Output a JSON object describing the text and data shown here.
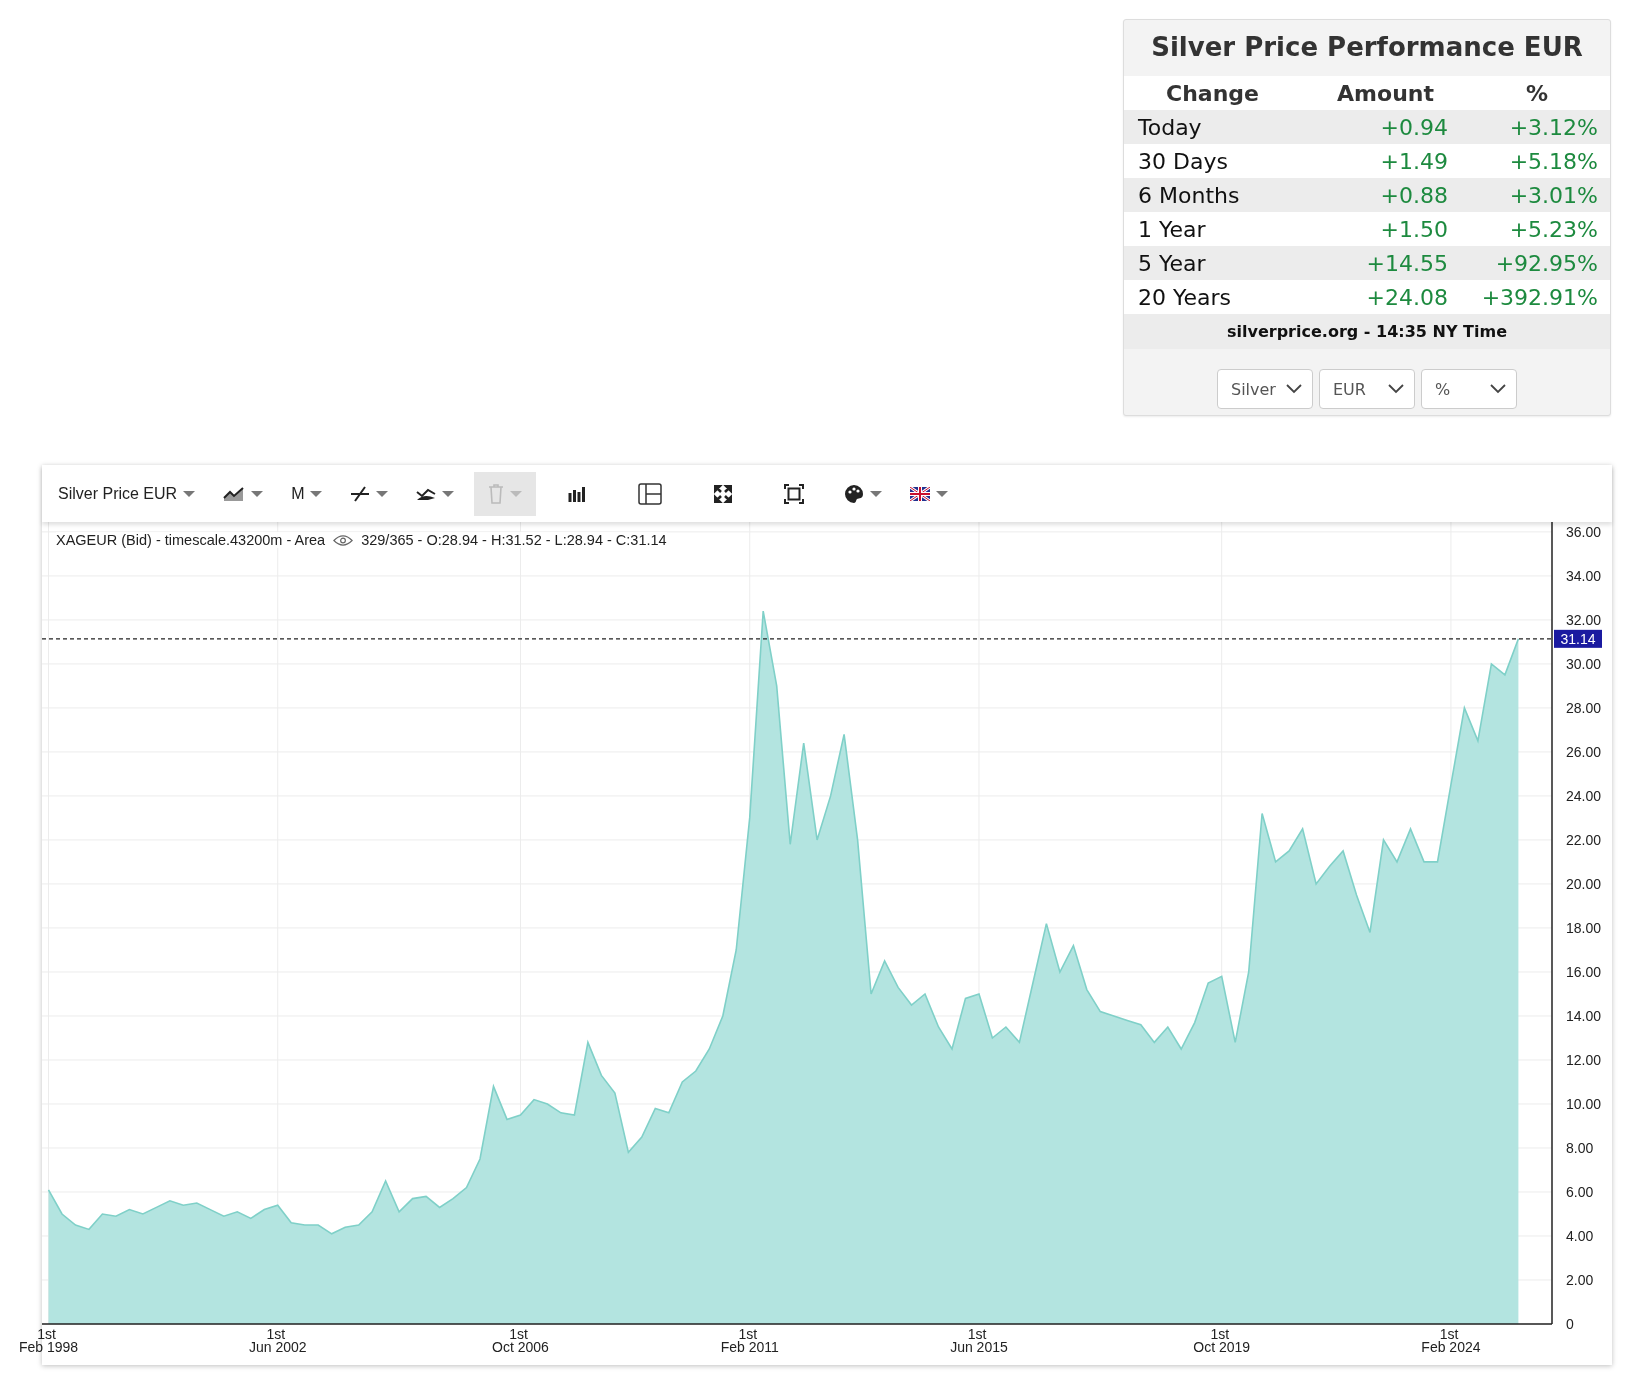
{
  "performance": {
    "title": "Silver Price Performance EUR",
    "columns": [
      "Change",
      "Amount",
      "%"
    ],
    "rows": [
      {
        "period": "Today",
        "amount": "+0.94",
        "percent": "+3.12%"
      },
      {
        "period": "30 Days",
        "amount": "+1.49",
        "percent": "+5.18%"
      },
      {
        "period": "6 Months",
        "amount": "+0.88",
        "percent": "+3.01%"
      },
      {
        "period": "1 Year",
        "amount": "+1.50",
        "percent": "+5.23%"
      },
      {
        "period": "5 Year",
        "amount": "+14.55",
        "percent": "+92.95%"
      },
      {
        "period": "20 Years",
        "amount": "+24.08",
        "percent": "+392.91%"
      }
    ],
    "footer": "silverprice.org - 14:35 NY Time",
    "selects": [
      {
        "value": "Silver"
      },
      {
        "value": "EUR"
      },
      {
        "value": "%"
      }
    ]
  },
  "chart": {
    "toolbar": {
      "symbol": "Silver Price EUR",
      "interval": "M",
      "delete_disabled": true
    },
    "legend": {
      "series": "XAGEUR (Bid) - timescale.43200m - Area",
      "stats": "329/365 - O:28.94 - H:31.52 - L:28.94 - C:31.14"
    },
    "chart_data": {
      "type": "area",
      "categories": [
        "1st Feb 1998",
        null,
        null,
        null,
        null,
        null,
        null,
        null,
        null,
        null,
        null,
        null,
        null,
        null,
        null,
        null,
        null,
        "1st Jun 2002",
        null,
        null,
        null,
        null,
        null,
        null,
        null,
        null,
        null,
        null,
        null,
        null,
        null,
        null,
        null,
        null,
        null,
        "1st Oct 2006",
        null,
        null,
        null,
        null,
        null,
        null,
        null,
        null,
        null,
        null,
        null,
        null,
        null,
        null,
        null,
        null,
        "1st Feb 2011",
        null,
        null,
        null,
        null,
        null,
        null,
        null,
        null,
        null,
        null,
        null,
        null,
        null,
        null,
        null,
        null,
        "1st Jun 2015",
        null,
        null,
        null,
        null,
        null,
        null,
        null,
        null,
        null,
        null,
        null,
        null,
        null,
        null,
        null,
        null,
        null,
        "1st Oct 2019",
        null,
        null,
        null,
        null,
        null,
        null,
        null,
        null,
        null,
        null,
        null,
        null,
        null,
        null,
        null,
        null,
        "1st Feb 2024",
        null,
        null,
        null,
        null,
        null
      ],
      "values": [
        6.1,
        5.0,
        4.5,
        4.3,
        5.0,
        4.9,
        5.2,
        5.0,
        5.3,
        5.6,
        5.4,
        5.5,
        5.2,
        4.9,
        5.1,
        4.8,
        5.2,
        5.4,
        4.6,
        4.5,
        4.5,
        4.1,
        4.4,
        4.5,
        5.1,
        6.5,
        5.1,
        5.7,
        5.8,
        5.3,
        5.7,
        6.2,
        7.5,
        10.8,
        9.3,
        9.5,
        10.2,
        10.0,
        9.6,
        9.5,
        12.8,
        11.3,
        10.5,
        7.8,
        8.5,
        9.8,
        9.6,
        11.0,
        11.5,
        12.5,
        14.0,
        17.0,
        23.0,
        32.4,
        29.0,
        21.8,
        26.4,
        22.0,
        24.0,
        26.8,
        22.0,
        15.0,
        16.5,
        15.3,
        14.5,
        15.0,
        13.5,
        12.5,
        14.8,
        15.0,
        13.0,
        13.5,
        12.8,
        15.5,
        18.2,
        16.0,
        17.2,
        15.2,
        14.2,
        14.0,
        13.8,
        13.6,
        12.8,
        13.5,
        12.5,
        13.7,
        15.5,
        15.8,
        12.8,
        16.0,
        23.2,
        21.0,
        21.5,
        22.5,
        20.0,
        20.8,
        21.5,
        19.5,
        17.8,
        22.0,
        21.0,
        22.5,
        21.0,
        21.0,
        24.5,
        28.0,
        26.5,
        30.0,
        29.5,
        31.14
      ],
      "ylim": [
        0,
        36.45
      ],
      "yticks": [
        {
          "value": 0,
          "label": "0"
        },
        {
          "value": 2,
          "label": "2.00"
        },
        {
          "value": 4,
          "label": "4.00"
        },
        {
          "value": 6,
          "label": "6.00"
        },
        {
          "value": 8,
          "label": "8.00"
        },
        {
          "value": 10,
          "label": "10.00"
        },
        {
          "value": 12,
          "label": "12.00"
        },
        {
          "value": 14,
          "label": "14.00"
        },
        {
          "value": 16,
          "label": "16.00"
        },
        {
          "value": 18,
          "label": "18.00"
        },
        {
          "value": 20,
          "label": "20.00"
        },
        {
          "value": 22,
          "label": "22.00"
        },
        {
          "value": 24,
          "label": "24.00"
        },
        {
          "value": 26,
          "label": "26.00"
        },
        {
          "value": 28,
          "label": "28.00"
        },
        {
          "value": 30,
          "label": "30.00"
        },
        {
          "value": 32,
          "label": "32.00"
        },
        {
          "value": 34,
          "label": "34.00"
        },
        {
          "value": 36,
          "label": "36.00"
        }
      ],
      "grid": true,
      "ref_lines": [
        {
          "axis": "y",
          "value": 31.14,
          "label": "31.14"
        }
      ]
    }
  }
}
